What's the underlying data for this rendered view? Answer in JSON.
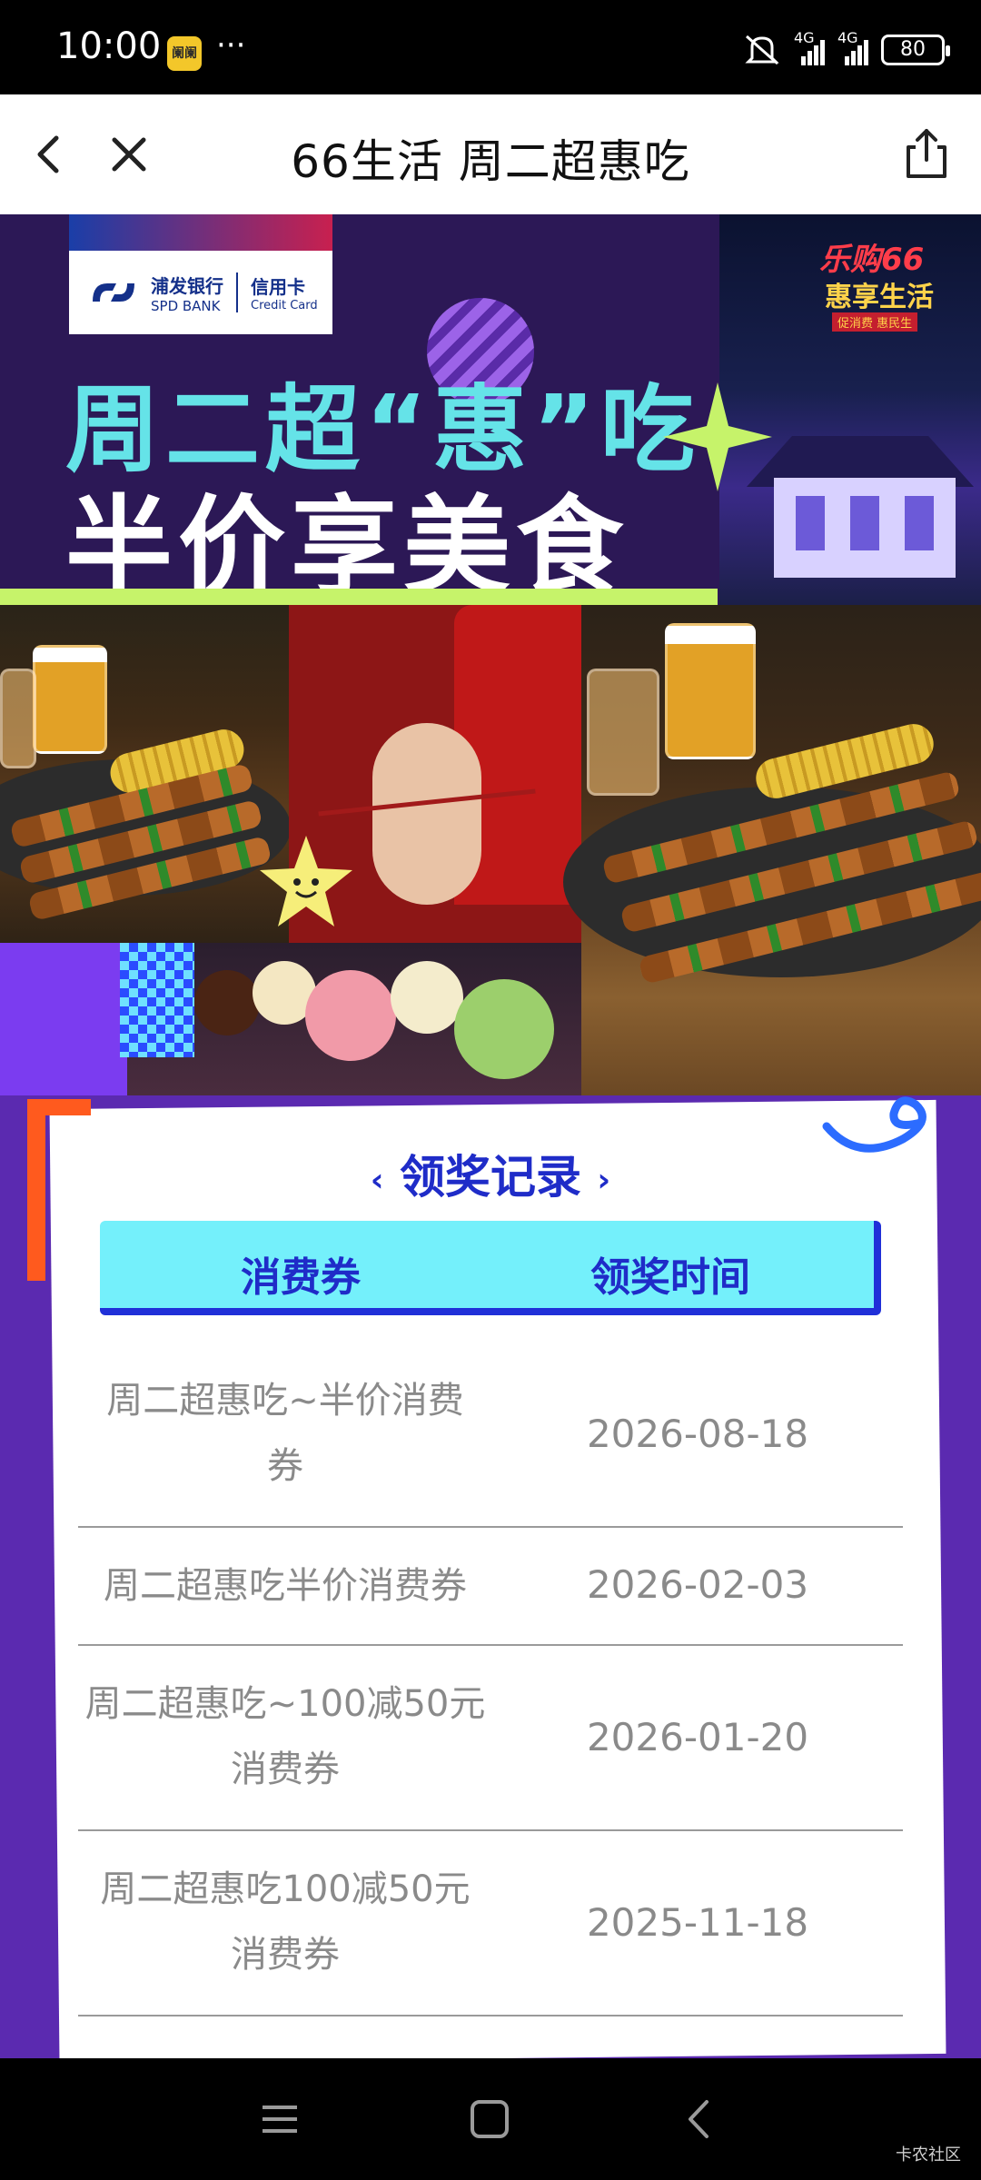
{
  "status_bar": {
    "time": "10:00",
    "app_icon": "阑阑",
    "more": "···",
    "network_1": "4G",
    "network_2": "4G",
    "battery": "80"
  },
  "nav": {
    "title": "66生活 周二超惠吃"
  },
  "banner": {
    "bank_name_cn": "浦发银行",
    "bank_name_en": "SPD BANK",
    "card_cn": "信用卡",
    "card_en": "Credit Card",
    "headline_1": "周二超“惠”吃",
    "headline_2": "半价享美食",
    "promo_line_1": "乐购66",
    "promo_line_2": "惠享生活",
    "promo_line_3": "促消费 惠民生"
  },
  "record": {
    "title": "领奖记录",
    "columns": [
      "消费券",
      "领奖时间"
    ],
    "rows": [
      {
        "name_line1": "周二超惠吃~半价消费",
        "name_line2": "券",
        "date": "2026-08-18"
      },
      {
        "name_line1": "周二超惠吃半价消费券",
        "name_line2": "",
        "date": "2026-02-03"
      },
      {
        "name_line1": "周二超惠吃~100减50元",
        "name_line2": "消费券",
        "date": "2026-01-20"
      },
      {
        "name_line1": "周二超惠吃100减50元",
        "name_line2": "消费券",
        "date": "2025-11-18"
      }
    ]
  },
  "watermark": "卡农社区",
  "colors": {
    "accent_blue": "#1f2cc8",
    "header_cyan": "#74f0fb",
    "page_purple": "#5b2ab0"
  }
}
